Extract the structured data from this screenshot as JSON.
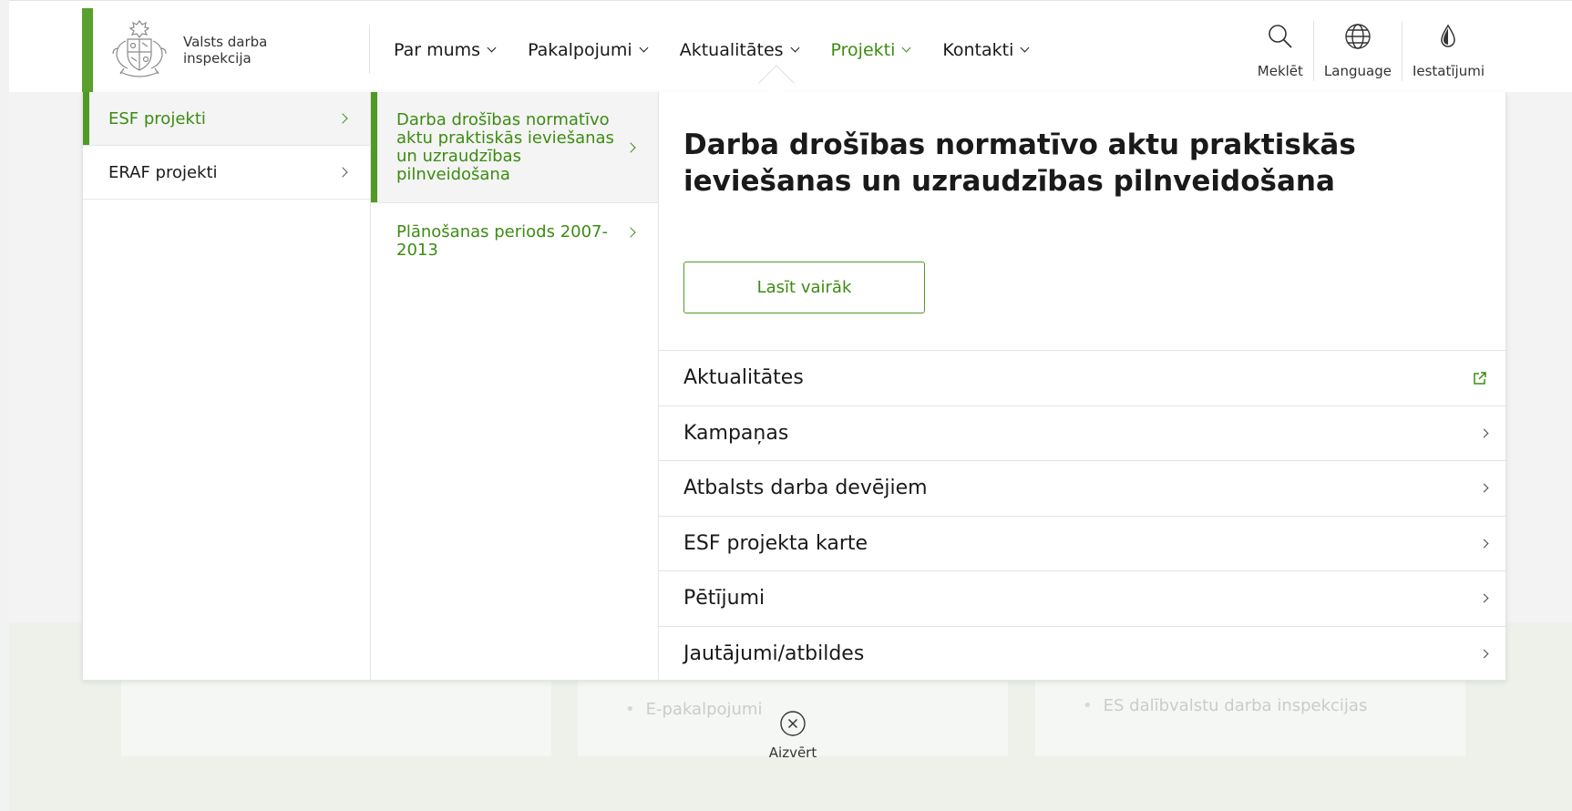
{
  "brand": {
    "name": "Valsts darba inspekcija"
  },
  "nav": [
    {
      "label": "Par mums",
      "active": false
    },
    {
      "label": "Pakalpojumi",
      "active": false
    },
    {
      "label": "Aktualitātes",
      "active": false
    },
    {
      "label": "Projekti",
      "active": true
    },
    {
      "label": "Kontakti",
      "active": false
    }
  ],
  "tools": {
    "search": {
      "label": "Meklēt",
      "icon": "search-icon"
    },
    "language": {
      "label": "Language",
      "icon": "globe-icon"
    },
    "settings": {
      "label": "Iestatījumi",
      "icon": "drop-icon"
    }
  },
  "mega_menu": {
    "level1": [
      {
        "label": "ESF projekti",
        "active": true
      },
      {
        "label": "ERAF projekti",
        "active": false
      }
    ],
    "level2": [
      {
        "label": "Darba drošības normatīvo aktu praktiskās ieviešanas un uzraudzības pilnveidošana",
        "active": true
      },
      {
        "label": "Plānošanas periods 2007-2013",
        "active": false
      }
    ],
    "feature": {
      "title": "Darba drošības normatīvo aktu praktiskās ieviešanas un uzraudzības pilnveidošana",
      "button_label": "Lasīt vairāk"
    },
    "links": [
      {
        "label": "Aktualitātes",
        "icon": "external-link-icon"
      },
      {
        "label": "Kampaņas",
        "icon": "chevron-right-icon"
      },
      {
        "label": "Atbalsts darba devējiem",
        "icon": "chevron-right-icon"
      },
      {
        "label": "ESF projekta karte",
        "icon": "chevron-right-icon"
      },
      {
        "label": "Pētījumi",
        "icon": "chevron-right-icon"
      },
      {
        "label": "Jautājumi/atbildes",
        "icon": "chevron-right-icon"
      }
    ]
  },
  "close": {
    "label": "Aizvērt",
    "icon": "close-circle-icon"
  },
  "background": {
    "items": [
      "E-pakalpojumi",
      "ES dalībvalstu darba inspekcijas"
    ]
  },
  "colors": {
    "accent": "#3c8c11",
    "brand_bar": "#5aa02c"
  }
}
